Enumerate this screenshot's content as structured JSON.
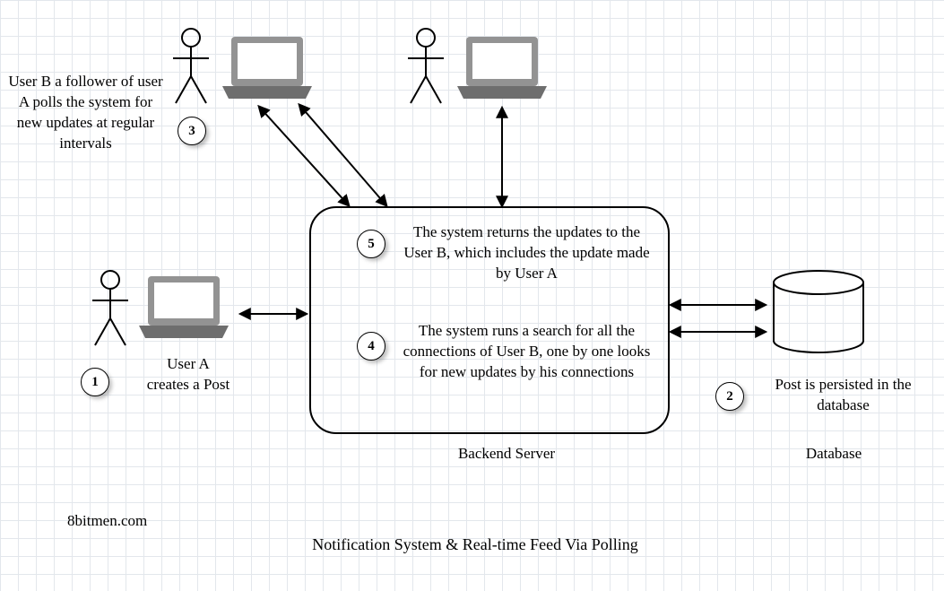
{
  "title": "Notification System & Real-time Feed Via Polling",
  "credit": "8bitmen.com",
  "labels": {
    "backend_server": "Backend Server",
    "database": "Database",
    "user_a_caption": "User A\ncreates a Post",
    "user_b_caption": "User B a follower of user A polls the system for new updates at regular intervals",
    "db_caption": "Post is persisted in the database"
  },
  "steps": {
    "1": "1",
    "2": "2",
    "3": "3",
    "4": "4",
    "5": "5"
  },
  "step_text": {
    "4": "The system runs a search for all the connections of User B, one by one looks for new updates by his connections",
    "5": "The system returns the updates to the User B, which includes the update made by User A"
  }
}
